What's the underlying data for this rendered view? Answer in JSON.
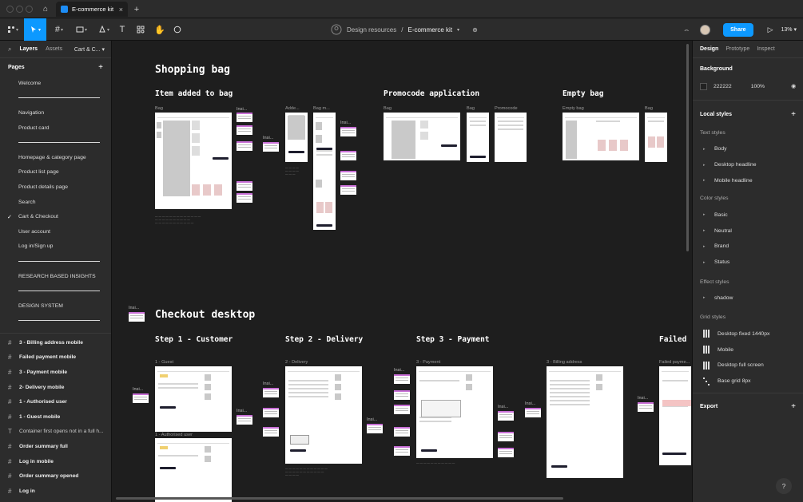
{
  "browser": {
    "tab_title": "E-commerce kit",
    "close_glyph": "×",
    "new_tab_glyph": "+",
    "home_glyph": "⌂"
  },
  "toolbar": {
    "breadcrumb_project": "Design resources",
    "breadcrumb_sep": "/",
    "breadcrumb_file": "E-commerce kit",
    "share_label": "Share",
    "zoom": "13%",
    "play_glyph": "▷",
    "present_glyph": "⌢"
  },
  "left_panel": {
    "tabs": [
      "Layers",
      "Assets"
    ],
    "page_selector": "Cart & C...",
    "pages_heading": "Pages",
    "add_glyph": "+",
    "pages": [
      {
        "label": "Welcome",
        "sep": false
      },
      {
        "label": "",
        "sep": true
      },
      {
        "label": "Navigation",
        "sep": false
      },
      {
        "label": "Product card",
        "sep": false
      },
      {
        "label": "",
        "sep": true
      },
      {
        "label": "Homepage & category page",
        "sep": false
      },
      {
        "label": "Product list page",
        "sep": false
      },
      {
        "label": "Product details page",
        "sep": false
      },
      {
        "label": "Search",
        "sep": false
      },
      {
        "label": "Cart & Checkout",
        "sep": false,
        "checked": true
      },
      {
        "label": "User account",
        "sep": false
      },
      {
        "label": "Log in/Sign up",
        "sep": false
      },
      {
        "label": "",
        "sep": true
      },
      {
        "label": "RESEARCH BASED INSIGHTS",
        "sep": false
      },
      {
        "label": "",
        "sep": true
      },
      {
        "label": "DESIGN SYSTEM",
        "sep": false
      },
      {
        "label": "",
        "sep": true
      }
    ],
    "layers": [
      {
        "label": "3 - Billing address mobile",
        "icon": "#"
      },
      {
        "label": "Failed payment mobile",
        "icon": "#"
      },
      {
        "label": "3 - Payment mobile",
        "icon": "#"
      },
      {
        "label": "2- Delivery mobile",
        "icon": "#"
      },
      {
        "label": "1 - Authorised user",
        "icon": "#"
      },
      {
        "label": "1 - Guest mobile",
        "icon": "#"
      },
      {
        "label": "Container first opens not in a full h...",
        "icon": "T",
        "plain": true
      },
      {
        "label": "Order summary full",
        "icon": "#"
      },
      {
        "label": "Log in mobile",
        "icon": "#"
      },
      {
        "label": "Order summary opened",
        "icon": "#"
      },
      {
        "label": "Log in",
        "icon": "#"
      }
    ]
  },
  "canvas": {
    "shopping_bag_title": "Shopping bag",
    "item_added_title": "Item added to bag",
    "promocode_title": "Promocode application",
    "empty_bag_title": "Empty bag",
    "checkout_title": "Checkout desktop",
    "step1_title": "Step 1 - Customer",
    "step2_title": "Step 2 - Delivery",
    "step3_title": "Step 3 - Payment",
    "failed_title": "Failed",
    "frame_labels": {
      "bag1": "Bag",
      "insi1": "Insi...",
      "adde": "Adde...",
      "bagm": "Bag m...",
      "bag2": "Bag",
      "bag3": "Bag",
      "promocode": "Promocode",
      "emptybag": "Empty bag",
      "bag4": "Bag",
      "guest": "1 - Guest",
      "authorised": "1 - Authorised user",
      "delivery": "2 - Delivery",
      "payment": "3 - Payment",
      "billing": "3 - Billing address",
      "failedpay": "Failed payme..."
    },
    "note_label": "Insi..."
  },
  "right_panel": {
    "tabs": [
      "Design",
      "Prototype",
      "Inspect"
    ],
    "background_heading": "Background",
    "background_hex": "222222",
    "background_opacity": "100%",
    "local_styles_heading": "Local styles",
    "text_styles_heading": "Text styles",
    "text_styles": [
      "Body",
      "Desktop headline",
      "Mobile headline"
    ],
    "color_styles_heading": "Color styles",
    "color_styles": [
      "Basic",
      "Neutral",
      "Brand",
      "Status"
    ],
    "effect_styles_heading": "Effect styles",
    "effect_styles": [
      "shadow"
    ],
    "grid_styles_heading": "Grid styles",
    "grid_styles": [
      "Desktop fixed 1440px",
      "Mobile",
      "Desktop full screen",
      "Base grid 8px"
    ],
    "export_heading": "Export",
    "help_glyph": "?"
  },
  "colors": {
    "accent": "#0d99ff",
    "canvas_bg": "#1e1e1e",
    "panel_bg": "#2c2c2c",
    "note_accent": "#c86fd6"
  }
}
